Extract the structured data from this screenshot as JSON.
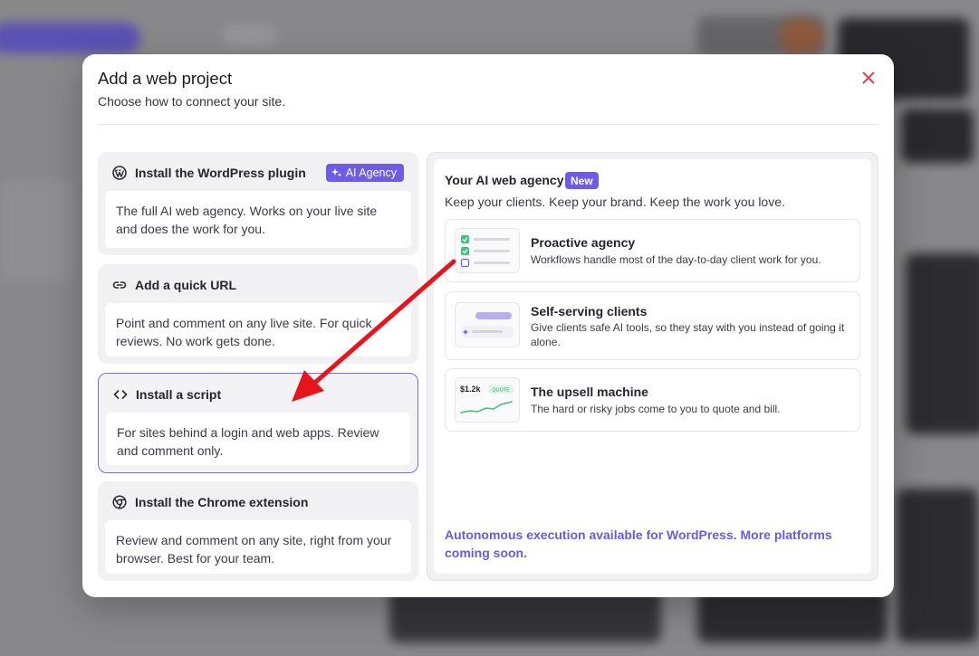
{
  "modal": {
    "title": "Add a web project",
    "subtitle": "Choose how to connect your site."
  },
  "options": [
    {
      "icon": "wordpress-icon",
      "title": "Install the WordPress plugin",
      "badge": "AI Agency",
      "body": "The full AI web agency. Works on your live site and does the work for you."
    },
    {
      "icon": "link-icon",
      "title": "Add a quick URL",
      "body": "Point and comment on any live site. For quick reviews. No work gets done."
    },
    {
      "icon": "code-icon",
      "title": "Install a script",
      "body": "For sites behind a login and web apps. Review and comment only.",
      "selected": true
    },
    {
      "icon": "chrome-icon",
      "title": "Install the Chrome extension",
      "body": "Review and comment on any site, right from your browser. Best for your team."
    }
  ],
  "agency": {
    "title": "Your AI web agency",
    "new_badge": "New",
    "subtitle": "Keep your clients. Keep your brand. Keep the work you love.",
    "features": [
      {
        "title": "Proactive agency",
        "desc": "Workflows handle most of the day-to-day client work for you."
      },
      {
        "title": "Self-serving clients",
        "desc": "Give clients safe AI tools, so they stay with you instead of going it alone."
      },
      {
        "title": "The upsell machine",
        "desc": "The hard or risky jobs come to you to quote and bill.",
        "thumb_price": "$1.2k",
        "thumb_tag": "QUOTE"
      }
    ],
    "footnote": "Autonomous execution available for WordPress. More platforms coming soon."
  },
  "colors": {
    "accent": "#6f5ce6",
    "close": "#e0435c",
    "arrow": "#e8141c",
    "check": "#3fc27a"
  }
}
